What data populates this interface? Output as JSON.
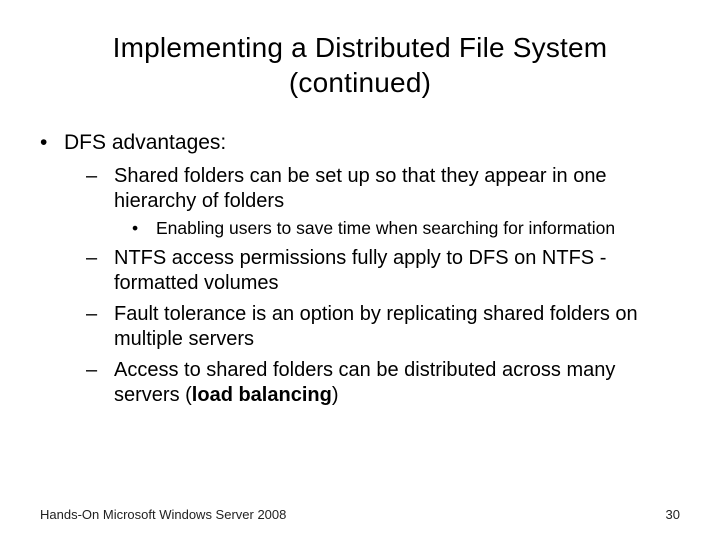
{
  "title": "Implementing a Distributed File System (continued)",
  "bullets": {
    "l1_0": "DFS advantages:",
    "l2_0": "Shared folders can be set up so that they appear in one hierarchy of folders",
    "l3_0": "Enabling users to save time when searching for information",
    "l2_1": "NTFS access permissions fully apply to DFS on NTFS -formatted volumes",
    "l2_2": "Fault tolerance is an option by replicating shared folders on multiple servers",
    "l2_3_pre": "Access to shared folders can be distributed across many servers (",
    "l2_3_bold": "load balancing",
    "l2_3_post": ")"
  },
  "markers": {
    "dot": "•",
    "dash": "–"
  },
  "footer": {
    "book": "Hands-On Microsoft Windows Server 2008",
    "page": "30"
  }
}
